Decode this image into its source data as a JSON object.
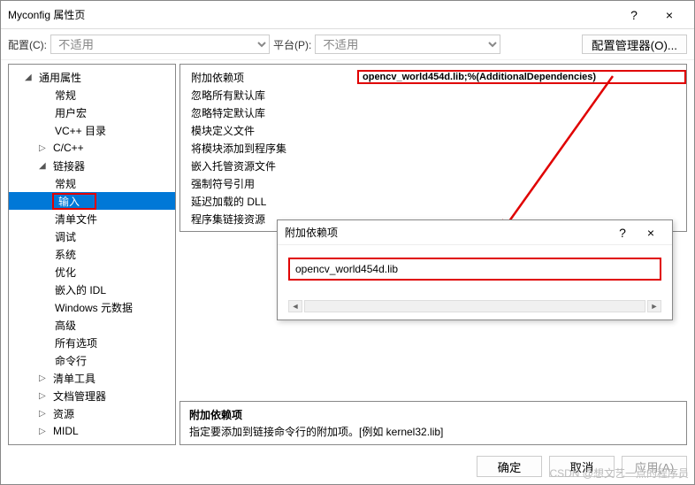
{
  "titlebar": {
    "title": "Myconfig 属性页",
    "help": "?",
    "close": "×"
  },
  "configrow": {
    "config_label": "配置(C):",
    "config_value": "不适用",
    "platform_label": "平台(P):",
    "platform_value": "不适用",
    "manager_btn": "配置管理器(O)..."
  },
  "tree": {
    "root": "通用属性",
    "items1": [
      "常规",
      "用户宏",
      "VC++ 目录"
    ],
    "cxx": "C/C++",
    "linker": "链接器",
    "linker_items": [
      "常规",
      "输入",
      "清单文件",
      "调试",
      "系统",
      "优化",
      "嵌入的 IDL",
      "Windows 元数据",
      "高级",
      "所有选项",
      "命令行"
    ],
    "items2": [
      "清单工具",
      "文档管理器",
      "资源",
      "MIDL"
    ]
  },
  "props": {
    "rows": [
      {
        "name": "附加依赖项",
        "value": "opencv_world454d.lib;%(AdditionalDependencies)"
      },
      {
        "name": "忽略所有默认库",
        "value": ""
      },
      {
        "name": "忽略特定默认库",
        "value": ""
      },
      {
        "name": "模块定义文件",
        "value": ""
      },
      {
        "name": "将模块添加到程序集",
        "value": ""
      },
      {
        "name": "嵌入托管资源文件",
        "value": ""
      },
      {
        "name": "强制符号引用",
        "value": ""
      },
      {
        "name": "延迟加载的 DLL",
        "value": ""
      },
      {
        "name": "程序集链接资源",
        "value": ""
      }
    ]
  },
  "dialog": {
    "title": "附加依赖项",
    "help": "?",
    "close": "×",
    "input": "opencv_world454d.lib"
  },
  "desc": {
    "title": "附加依赖项",
    "text": "指定要添加到链接命令行的附加项。[例如 kernel32.lib]"
  },
  "buttons": {
    "ok": "确定",
    "cancel": "取消",
    "apply": "应用(A)"
  },
  "watermark": "CSDN @想文艺一点的程序员"
}
